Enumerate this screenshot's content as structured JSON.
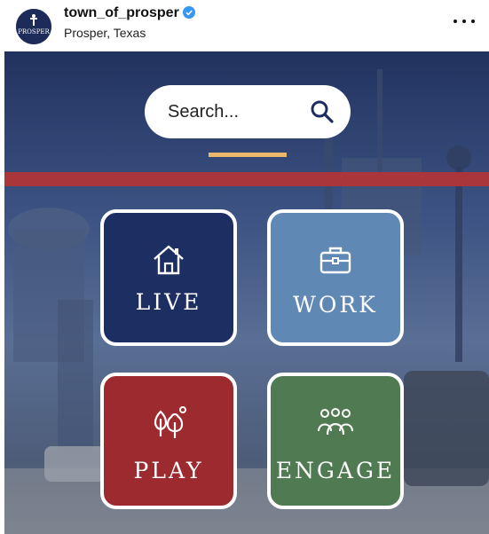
{
  "post_header": {
    "username": "town_of_prosper",
    "location": "Prosper, Texas",
    "avatar_text": "PROSPER",
    "verified_icon": "verified-badge-icon",
    "more_icon": "more-options-icon"
  },
  "post_image": {
    "search": {
      "placeholder": "Search...",
      "icon": "search-icon"
    },
    "tiles": [
      {
        "label": "LIVE",
        "icon": "house-icon",
        "color": "#1d2e63"
      },
      {
        "label": "WORK",
        "icon": "briefcase-icon",
        "color": "#5f88b5"
      },
      {
        "label": "PLAY",
        "icon": "trees-icon",
        "color": "#9c2a2f"
      },
      {
        "label": "ENGAGE",
        "icon": "people-group-icon",
        "color": "#4f7a52"
      }
    ],
    "colors": {
      "accent_gold": "#e9b86a",
      "stripe_red": "#a8363a",
      "sky_top": "#22325f"
    }
  }
}
